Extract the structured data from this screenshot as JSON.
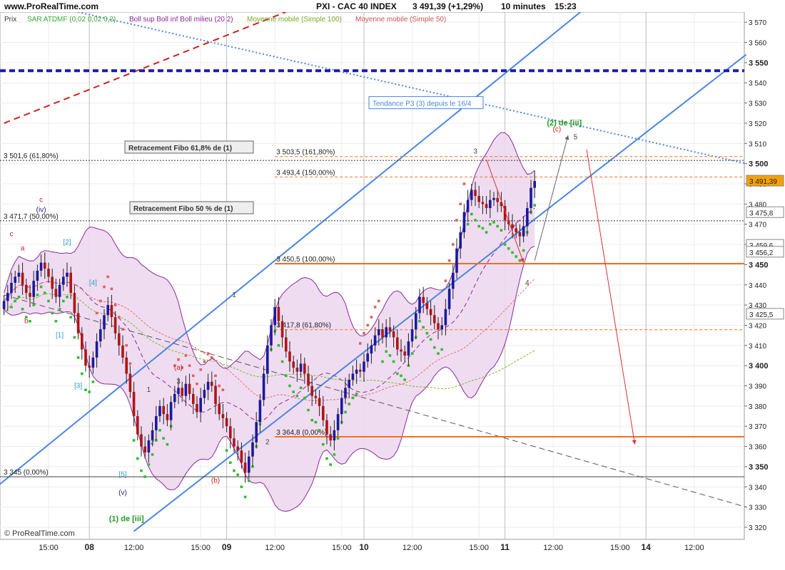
{
  "header": {
    "site": "www.ProRealTime.com",
    "title": "PXI - CAC 40 INDEX",
    "price": "3 491,39 (+1,29%)",
    "interval": "10 minutes",
    "time": "15:23"
  },
  "legend": {
    "prix": "Prix",
    "sar": "SAR ATDMF (0,02 0,02 0,2)",
    "boll": "Boll sup Boll inf Boll milieu (20 2)",
    "ma100": "Moyenne mobile (Simple 100)",
    "ma50": "Moyenne mobile (Simple 50)"
  },
  "copyright": "© ProRealTime.com",
  "colors": {
    "candle_up": "#1a1aa0",
    "candle_down": "#b01414",
    "bollinger_fill": "#eed8f0",
    "bollinger_line": "#8a2a9a",
    "sar": "#33bb33",
    "sar_bear": "#e06060",
    "channel": "#4a86e0",
    "fibo_orange": "#f07020",
    "resistance": "#1a1ab0"
  },
  "chart_data": {
    "type": "candlestick",
    "instrument": "PXI - CAC 40 INDEX",
    "interval": "10 minutes",
    "ylim": [
      3314,
      3575
    ],
    "y_ticks": [
      "3 320",
      "3 330",
      "3 340",
      "3 350",
      "3 360",
      "3 370",
      "3 380",
      "3 390",
      "3 400",
      "3 410",
      "3 420",
      "3 430",
      "3 440",
      "3 450",
      "3 460",
      "3 470",
      "3 480",
      "3 490",
      "3 500",
      "3 510",
      "3 520",
      "3 530",
      "3 540",
      "3 550",
      "3 560",
      "3 570"
    ],
    "y_tick_values": [
      3320,
      3330,
      3340,
      3350,
      3360,
      3370,
      3380,
      3390,
      3400,
      3410,
      3420,
      3430,
      3440,
      3450,
      3460,
      3470,
      3480,
      3490,
      3500,
      3510,
      3520,
      3530,
      3540,
      3550,
      3560,
      3570
    ],
    "bold_ticks": [
      "3 550",
      "3 500",
      "3 450",
      "3 400",
      "3 350"
    ],
    "x_labels": [
      {
        "label": "15:00",
        "bar": 12,
        "bold": false
      },
      {
        "label": "08",
        "bar": 23,
        "bold": true
      },
      {
        "label": "12:00",
        "bar": 35,
        "bold": false
      },
      {
        "label": "15:00",
        "bar": 53,
        "bold": false
      },
      {
        "label": "09",
        "bar": 60,
        "bold": true
      },
      {
        "label": "12:00",
        "bar": 73,
        "bold": false
      },
      {
        "label": "15:00",
        "bar": 91,
        "bold": false
      },
      {
        "label": "10",
        "bar": 97,
        "bold": true
      },
      {
        "label": "12:00",
        "bar": 110,
        "bold": false
      },
      {
        "label": "15:00",
        "bar": 128,
        "bold": false
      },
      {
        "label": "11",
        "bar": 135,
        "bold": true
      },
      {
        "label": "12:00",
        "bar": 148,
        "bold": false
      },
      {
        "label": "15:00",
        "bar": 166,
        "bold": false
      },
      {
        "label": "14",
        "bar": 173,
        "bold": true
      },
      {
        "label": "12:00",
        "bar": 186,
        "bold": false
      }
    ],
    "day_separators": [
      23,
      60,
      97,
      135,
      173
    ],
    "close_series": [
      3432,
      3436,
      3441,
      3444,
      3446,
      3440,
      3436,
      3434,
      3442,
      3447,
      3451,
      3448,
      3444,
      3438,
      3434,
      3440,
      3444,
      3446,
      3436,
      3426,
      3416,
      3408,
      3400,
      3399,
      3404,
      3412,
      3418,
      3425,
      3430,
      3424,
      3416,
      3410,
      3404,
      3396,
      3387,
      3375,
      3366,
      3360,
      3357,
      3363,
      3368,
      3375,
      3380,
      3376,
      3373,
      3382,
      3386,
      3389,
      3385,
      3391,
      3386,
      3381,
      3377,
      3384,
      3388,
      3392,
      3390,
      3381,
      3376,
      3374,
      3370,
      3364,
      3360,
      3358,
      3352,
      3347,
      3355,
      3362,
      3372,
      3383,
      3396,
      3410,
      3420,
      3429,
      3422,
      3414,
      3407,
      3402,
      3399,
      3397,
      3401,
      3396,
      3390,
      3385,
      3384,
      3380,
      3373,
      3366,
      3363,
      3368,
      3376,
      3384,
      3389,
      3393,
      3396,
      3398,
      3397,
      3402,
      3406,
      3410,
      3415,
      3418,
      3414,
      3419,
      3417,
      3414,
      3408,
      3407,
      3405,
      3412,
      3418,
      3426,
      3434,
      3431,
      3428,
      3425,
      3421,
      3418,
      3420,
      3428,
      3438,
      3446,
      3458,
      3466,
      3476,
      3482,
      3487,
      3484,
      3481,
      3480,
      3478,
      3482,
      3483,
      3481,
      3479,
      3472,
      3470,
      3468,
      3466,
      3464,
      3469,
      3478,
      3488,
      3491.39
    ],
    "open_first": 3428,
    "bars_visible": 122,
    "last_price": "3 491,39",
    "right_tags": [
      {
        "label": "3 491,39",
        "value": 3491.39,
        "bg": "#f5a000"
      },
      {
        "label": "3 475,8",
        "value": 3475.8,
        "bg": "#ffffff"
      },
      {
        "label": "3 459,6",
        "value": 3459.6,
        "bg": "#ffffff"
      },
      {
        "label": "3 456,2",
        "value": 3456.2,
        "bg": "#ffffff"
      },
      {
        "label": "3 425,5",
        "value": 3425.5,
        "bg": "#ffffff"
      }
    ],
    "horizontal_levels": [
      {
        "label": "3 501,6 (61,80%)",
        "value": 3501.6,
        "style": "dotted",
        "color": "#333333"
      },
      {
        "label": "3 471,7 (50,00%)",
        "value": 3471.7,
        "style": "dotted",
        "color": "#333333"
      },
      {
        "label": "3 345 (0,00%)",
        "value": 3345,
        "style": "solid",
        "color": "#444444"
      },
      {
        "label": "3 503,5 (161,80%)",
        "value": 3503.5,
        "style": "dashed",
        "color": "#f07020"
      },
      {
        "label": "3 493,4 (150,00%)",
        "value": 3493.4,
        "style": "dashed",
        "color": "#f07020"
      },
      {
        "label": "3 450,5 (100,00%)",
        "value": 3450.5,
        "style": "solid",
        "color": "#f07020"
      },
      {
        "label": "3 417,8 (61,80%)",
        "value": 3417.8,
        "style": "dashed",
        "color": "#f07020"
      },
      {
        "label": "3 364,8 (0,00%)",
        "value": 3364.8,
        "style": "solid",
        "color": "#f07020"
      },
      {
        "label": "",
        "value": 3546,
        "style": "bolddash",
        "color": "#1a1ab0"
      }
    ],
    "boxes": [
      "Retracement Fibo 61,8% de (1)",
      "Retracement Fibo 50 % de (1)",
      "Tendance P3 (3) depuis le 16/4"
    ],
    "wave_labels": {
      "a": "a",
      "c": "c",
      "b": "b",
      "two": "[2]",
      "four": "[4]",
      "one": "[1]",
      "three": "[3]",
      "five": "[5]",
      "v": "(v)",
      "wave1iii": "(1) de [iii]",
      "wave2iii": "(2) de [iii]",
      "pa": "(a)",
      "pb": "(b)",
      "pc": "(c)",
      "n1": "1",
      "n2": "2",
      "n3": "3",
      "n4": "4",
      "n5": "5",
      "iv": "(iv)"
    }
  }
}
